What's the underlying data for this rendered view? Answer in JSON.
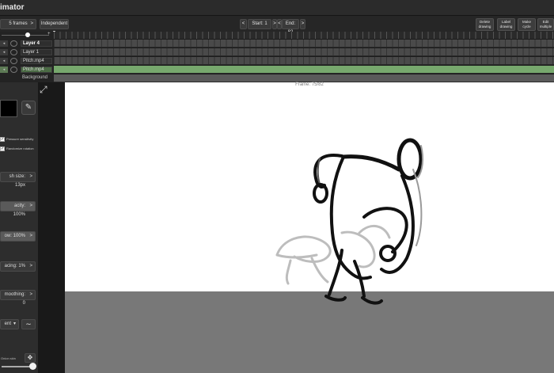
{
  "app": {
    "title": "imator"
  },
  "toolbar": {
    "frames": "5 frames",
    "frames_caret": ">",
    "mode": "Independent",
    "start_label": "Start: 1",
    "end_label": "End: 82",
    "prev": "<",
    "next": ">",
    "buttons": {
      "delete": "Delete drawing",
      "label": "Label drawing",
      "cycle": "Make cycle",
      "multiple": "Edit multiple"
    }
  },
  "layers": [
    {
      "name": "Layer 4",
      "active": true
    },
    {
      "name": "Layer 1",
      "active": false
    },
    {
      "name": "Pitch.mp4",
      "active": false
    },
    {
      "name": "Pitch.mp4",
      "active": false
    },
    {
      "name": "Background",
      "active": false
    }
  ],
  "canvas": {
    "frame_counter": "Frame: 75/82"
  },
  "sidebar": {
    "pressure_sensitivity": "Pressure sensitivity",
    "randomize_rotation": "Randomize rotation",
    "brush_size": "sh size: 13px",
    "opacity": "acity: 100%",
    "flow": "ow: 100%",
    "spacing": "acing: 1%",
    "smoothing": "moothing: 0",
    "blend": "ent",
    "onion": "Onion skin"
  },
  "colors": {
    "track_green": "#77a86d",
    "canvas_bg": "#ffffff",
    "ground": "#787878",
    "current_color": "#000000"
  }
}
